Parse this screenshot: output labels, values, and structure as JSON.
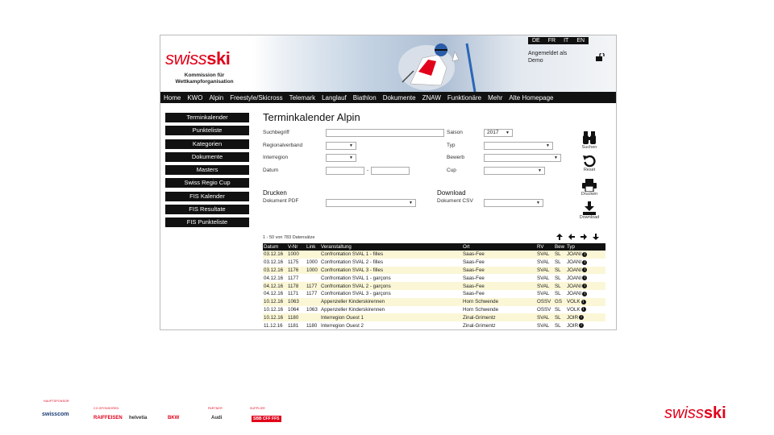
{
  "header": {
    "logo_swiss": "swiss",
    "logo_ski": "ski",
    "tagline_line1": "Kommission für",
    "tagline_line2": "Wettkampforganisation",
    "languages": [
      "DE",
      "FR",
      "IT",
      "EN"
    ],
    "login_line1": "Angemeldet als",
    "login_line2": "Demo"
  },
  "nav": [
    "Home",
    "KWO",
    "Alpin",
    "Freestyle/Skicross",
    "Telemark",
    "Langlauf",
    "Biathlon",
    "Dokumente",
    "ZNAW",
    "Funktionäre",
    "Mehr",
    "Alte Homepage"
  ],
  "sidebar": [
    "Terminkalender",
    "Punkteliste",
    "Kategorien",
    "Dokumente",
    "Masters",
    "Swiss Regio Cup",
    "FIS Kalender",
    "FIS Resultate",
    "FIS Punkteliste"
  ],
  "main": {
    "title": "Terminkalender Alpin",
    "search": {
      "suchbegriff_label": "Suchbegriff",
      "regionalverband_label": "Regionalverband",
      "interregion_label": "Interregion",
      "datum_label": "Datum",
      "datum_sep": "-",
      "saison_label": "Saison",
      "saison_value": "2017",
      "typ_label": "Typ",
      "bewerb_label": "Bewerb",
      "cup_label": "Cup"
    },
    "drucken": {
      "title": "Drucken",
      "label": "Dokument PDF"
    },
    "download": {
      "title": "Download",
      "label": "Dokument CSV"
    },
    "tools": {
      "suchen": "Suchen",
      "reset": "Reset",
      "drucken": "Drucken",
      "download": "Download"
    },
    "count_text": "1 - 50 von 783 Datensätze",
    "table": {
      "headers": [
        "Datum",
        "V-Nr",
        "Link",
        "Veranstaltung",
        "Ort",
        "RV",
        "Bew",
        "Typ"
      ],
      "rows": [
        [
          "03.12.16",
          "1000",
          "",
          "Confrontation SVAL 1 - filles",
          "Saas-Fee",
          "SVAL",
          "SL",
          "JOANI"
        ],
        [
          "03.12.16",
          "1175",
          "1000",
          "Confrontation SVAL 2 - filles",
          "Saas-Fee",
          "SVAL",
          "SL",
          "JOANI"
        ],
        [
          "03.12.16",
          "1176",
          "1000",
          "Confrontation SVAL 3 - filles",
          "Saas-Fee",
          "SVAL",
          "SL",
          "JOANI"
        ],
        [
          "04.12.16",
          "1177",
          "",
          "Confrontation SVAL 1 - garçons",
          "Saas-Fee",
          "SVAL",
          "SL",
          "JOANI"
        ],
        [
          "04.12.16",
          "1178",
          "1177",
          "Confrontation SVAL 2 - garçons",
          "Saas-Fee",
          "SVAL",
          "SL",
          "JOANI"
        ],
        [
          "04.12.16",
          "1171",
          "1177",
          "Confrontation SVAL 3 - garçons",
          "Saas-Fee",
          "SVAL",
          "SL",
          "JOANI"
        ],
        [
          "10.12.16",
          "1063",
          "",
          "Appenzeller Kinderskirennen",
          "Horn Schwende",
          "OSSV",
          "GS",
          "VOLK"
        ],
        [
          "10.12.16",
          "1064",
          "1063",
          "Appenzeller Kinderskirennen",
          "Horn Schwende",
          "OSSV",
          "SL",
          "VOLK"
        ],
        [
          "10.12.16",
          "1180",
          "",
          "Interregion Ouest 1",
          "Zinal-Grimentz",
          "SVAL",
          "SL",
          "JOIR"
        ],
        [
          "11.12.16",
          "1181",
          "1180",
          "Interregion Ouest 2",
          "Zinal-Grimentz",
          "SVAL",
          "SL",
          "JOIR"
        ]
      ]
    }
  },
  "footer": {
    "cap_haupt": "HAUPTSPONSOR",
    "cap_co": "CO-SPONSOREN",
    "cap_partner": "PARTNER",
    "cap_supplier": "SUPPLIER",
    "swisscom": "swisscom",
    "raiffeisen": "RAIFFEISEN",
    "helvetia": "helvetia",
    "bkw": "BKW",
    "audi": "Audi",
    "sbb": "SBB CFF FFS",
    "logo_swiss": "swiss",
    "logo_ski": "ski"
  },
  "colors": {
    "brand_red": "#e2001a",
    "nav_black": "#111111",
    "row_highlight": "#fbf7d6"
  }
}
